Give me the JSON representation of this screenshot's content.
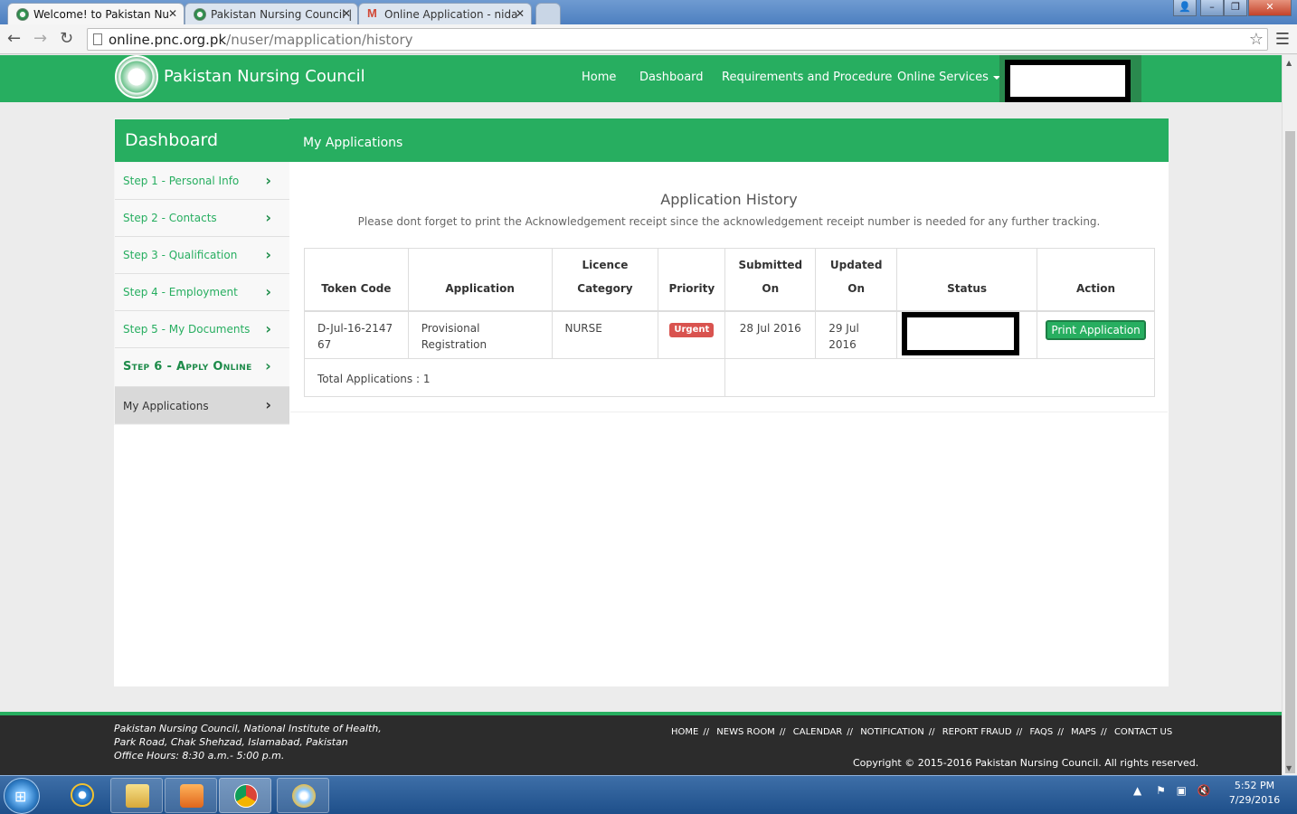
{
  "browser": {
    "tabs": [
      {
        "title": "Welcome! to Pakistan Nu",
        "icon": "pnc-favicon"
      },
      {
        "title": "Pakistan Nursing Council |",
        "icon": "pnc-favicon"
      },
      {
        "title": "Online Application - nida",
        "icon": "gmail-icon"
      }
    ],
    "url_host": "online.pnc.org.pk",
    "url_path": "/nuser/mapplication/history"
  },
  "header": {
    "brand": "Pakistan Nursing Council",
    "nav": {
      "home": "Home",
      "dashboard": "Dashboard",
      "requirements": "Requirements and Procedure",
      "online_services": "Online Services"
    }
  },
  "sidebar": {
    "title": "Dashboard",
    "items": [
      {
        "label": "Step 1 - Personal Info"
      },
      {
        "label": "Step 2 - Contacts"
      },
      {
        "label": "Step 3 - Qualification"
      },
      {
        "label": "Step 4 - Employment"
      },
      {
        "label": "Step 5 - My Documents"
      },
      {
        "label": "Step 6 - Apply Online"
      },
      {
        "label": "My Applications"
      }
    ]
  },
  "panel": {
    "title": "My Applications",
    "history_title": "Application History",
    "note": "Please dont forget to print the Acknowledgement receipt since the acknowledgement receipt number is needed for any further tracking."
  },
  "table": {
    "headers": {
      "token": "Token Code",
      "application": "Application",
      "licence_1": "Licence",
      "licence_2": "Category",
      "priority": "Priority",
      "submitted_1": "Submitted",
      "submitted_2": "On",
      "updated_1": "Updated",
      "updated_2": "On",
      "status": "Status",
      "action": "Action"
    },
    "row": {
      "token": "D-Jul-16-214767",
      "application": "Provisional Registration",
      "category": "NURSE",
      "priority": "Urgent",
      "submitted": "28 Jul 2016",
      "updated": "29 Jul 2016",
      "action": "Print Application"
    },
    "total": "Total Applications : 1"
  },
  "footer": {
    "address_1": "Pakistan Nursing Council, National Institute of Health,",
    "address_2": "Park Road, Chak Shehzad, Islamabad, Pakistan",
    "address_3": "Office Hours: 8:30 a.m.- 5:00 p.m.",
    "links": {
      "home": "HOME",
      "news": "NEWS ROOM",
      "calendar": "CALENDAR",
      "notification": "NOTIFICATION",
      "fraud": "REPORT FRAUD",
      "faqs": "FAQS",
      "maps": "MAPS",
      "contact": "CONTACT US"
    },
    "separator": "//",
    "copyright": "Copyright © 2015-2016 Pakistan Nursing Council. All rights reserved."
  },
  "taskbar": {
    "time": "5:52 PM",
    "date": "7/29/2016"
  },
  "colors": {
    "brand_green": "#27ae60",
    "urgent_red": "#d9534f",
    "footer_dark": "#2c2c2c"
  }
}
